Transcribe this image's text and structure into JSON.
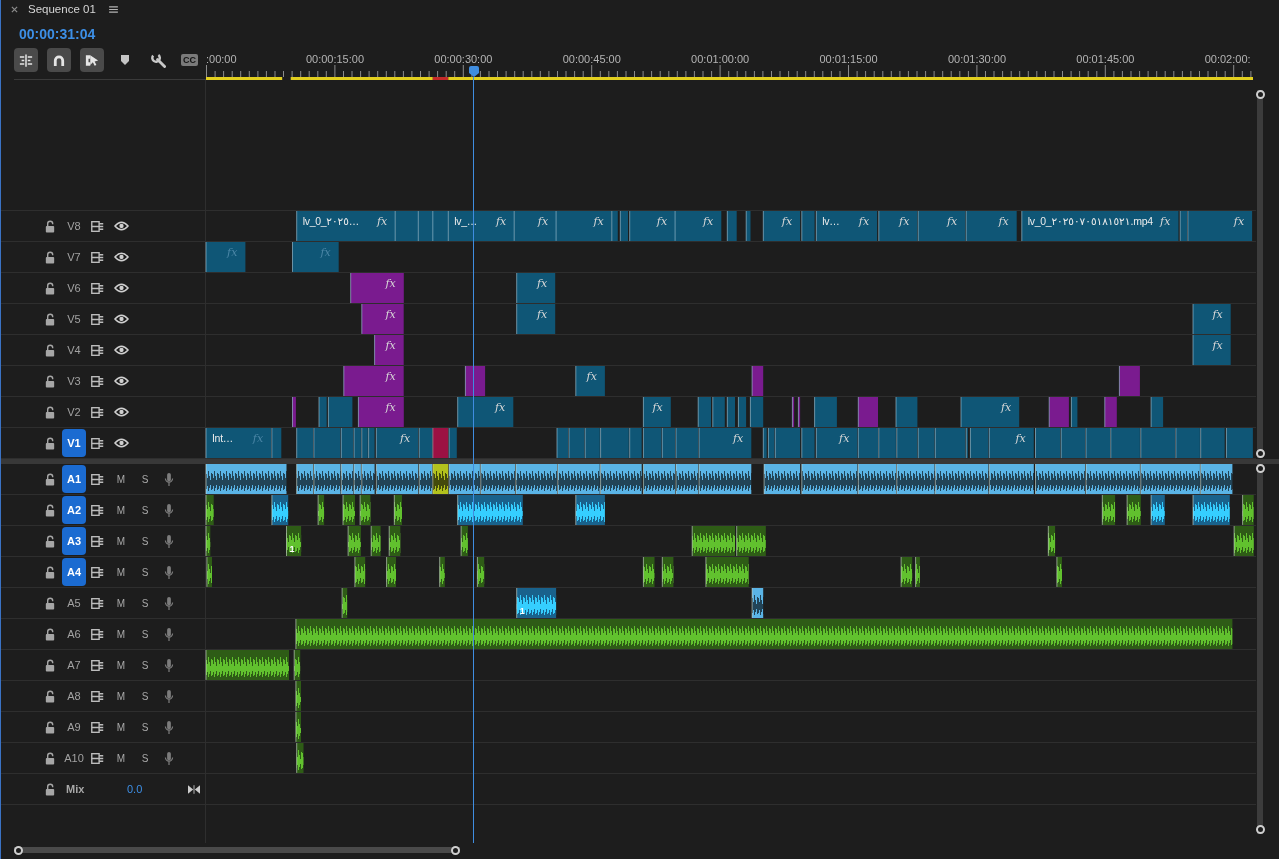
{
  "panel": {
    "title": "Sequence 01"
  },
  "timecode": "00:00:31:04",
  "toolbar": [
    {
      "kind": "nest",
      "on": true
    },
    {
      "kind": "snap",
      "on": true
    },
    {
      "kind": "linked",
      "on": true
    },
    {
      "kind": "marker",
      "on": false
    },
    {
      "kind": "settings",
      "on": false
    },
    {
      "kind": "captions",
      "on": false,
      "text": "CC"
    }
  ],
  "ruler": {
    "labels": [
      ":00:00",
      "00:00:15:00",
      "00:00:30:00",
      "00:00:45:00",
      "00:01:00:00",
      "00:01:15:00",
      "00:01:30:00",
      "00:01:45:00",
      "00:02:00:"
    ],
    "render_bar": [
      {
        "color": "#e2cf1f"
      },
      {
        "color": "#e2cf1f"
      },
      {
        "color": "#c42a2a"
      },
      {
        "color": "#e2cf1f"
      }
    ]
  },
  "video_tracks": [
    {
      "label": "V8",
      "targeted": false,
      "clips": [
        {
          "color": "#0f5676",
          "name": "lv_0_٢٠٢٥…",
          "badge": "fx",
          "badge_dim": false
        },
        {
          "color": "#0f5676"
        },
        {
          "color": "#0f5676"
        },
        {
          "color": "#0f5676"
        },
        {
          "color": "#0f5676",
          "name": "lv_…",
          "badge": "fx",
          "badge_dim": false
        },
        {
          "color": "#0f5676",
          "badge": "fx",
          "badge_dim": false
        },
        {
          "color": "#0f5676",
          "badge": "fx",
          "badge_dim": false
        },
        {
          "color": "#0f5676"
        },
        {
          "color": "#0f5676"
        },
        {
          "color": "#0f5676",
          "badge": "fx",
          "badge_dim": false
        },
        {
          "color": "#0f5676",
          "badge": "fx",
          "badge_dim": false
        },
        {
          "color": "#0f5676"
        },
        {
          "color": "#0f5676"
        },
        {
          "color": "#0f5676",
          "badge": "fx",
          "badge_dim": false
        },
        {
          "color": "#0f5676"
        },
        {
          "color": "#0f5676",
          "name": "lv…",
          "badge": "fx",
          "badge_dim": false
        },
        {
          "color": "#0f5676",
          "badge": "fx",
          "badge_dim": false
        },
        {
          "color": "#0f5676",
          "badge": "fx",
          "badge_dim": false
        },
        {
          "color": "#0f5676",
          "badge": "fx",
          "badge_dim": false
        },
        {
          "color": "#0f5676",
          "name": "lv_0_٢٠٢٥٠٧٠٥١٨١٥٢١.mp4",
          "badge": "fx",
          "badge_dim": false
        },
        {
          "color": "#0f5676"
        },
        {
          "color": "#0f5676",
          "badge": "fx",
          "badge_dim": false
        }
      ]
    },
    {
      "label": "V7",
      "targeted": false,
      "clips": [
        {
          "color": "#0f5676",
          "badge": "fx",
          "badge_dim": true
        },
        {
          "color": "#0f5676",
          "badge": "fx",
          "badge_dim": true
        }
      ]
    },
    {
      "label": "V6",
      "targeted": false,
      "clips": [
        {
          "color": "#7a1b8f",
          "badge": "fx",
          "badge_dim": false
        },
        {
          "color": "#0f5676",
          "badge": "fx",
          "badge_dim": false
        }
      ]
    },
    {
      "label": "V5",
      "targeted": false,
      "clips": [
        {
          "color": "#7a1b8f",
          "badge": "fx",
          "badge_dim": false
        },
        {
          "color": "#0f5676",
          "badge": "fx",
          "badge_dim": false
        },
        {
          "color": "#0f5676",
          "badge": "fx",
          "badge_dim": false
        }
      ]
    },
    {
      "label": "V4",
      "targeted": false,
      "clips": [
        {
          "color": "#7a1b8f",
          "badge": "fx",
          "badge_dim": false
        },
        {
          "color": "#0f5676",
          "badge": "fx",
          "badge_dim": false
        }
      ]
    },
    {
      "label": "V3",
      "targeted": false,
      "clips": [
        {
          "color": "#7a1b8f",
          "badge": "fx",
          "badge_dim": false
        },
        {
          "color": "#7a1b8f"
        },
        {
          "color": "#0f5676",
          "badge": "fx",
          "badge_dim": false
        },
        {
          "color": "#7a1b8f"
        },
        {
          "color": "#7a1b8f"
        }
      ]
    },
    {
      "label": "V2",
      "targeted": false,
      "clips": [
        {
          "color": "#7a1b8f"
        },
        {
          "color": "#0f5676"
        },
        {
          "color": "#0f5676"
        },
        {
          "color": "#7a1b8f",
          "badge": "fx",
          "badge_dim": false
        },
        {
          "color": "#0f5676",
          "badge": "fx",
          "badge_dim": false
        },
        {
          "color": "#0f5676",
          "badge": "fx",
          "badge_dim": false
        },
        {
          "color": "#0f5676"
        },
        {
          "color": "#0f5676"
        },
        {
          "color": "#0f5676"
        },
        {
          "color": "#0f5676"
        },
        {
          "color": "#0f5676"
        },
        {
          "color": "#7a1b8f"
        },
        {
          "color": "#7a1b8f"
        },
        {
          "color": "#0f5676"
        },
        {
          "color": "#7a1b8f"
        },
        {
          "color": "#0f5676"
        },
        {
          "color": "#0f5676",
          "badge": "fx",
          "badge_dim": false
        },
        {
          "color": "#7a1b8f"
        },
        {
          "color": "#0f5676"
        },
        {
          "color": "#7a1b8f"
        },
        {
          "color": "#0f5676"
        }
      ]
    },
    {
      "label": "V1",
      "targeted": true,
      "clips": [
        {
          "color": "#0f5676",
          "name": "Int…",
          "badge": "fx",
          "badge_dim": true
        },
        {
          "color": "#0f5676"
        },
        {
          "color": "#0f5676"
        },
        {
          "color": "#0f5676"
        },
        {
          "color": "#0f5676"
        },
        {
          "color": "#0f5676"
        },
        {
          "color": "#0f5676"
        },
        {
          "color": "#0f5676"
        },
        {
          "color": "#0f5676",
          "badge": "fx",
          "badge_dim": false
        },
        {
          "color": "#0f5676"
        },
        {
          "color": "#9c1143"
        },
        {
          "color": "#0f5676"
        },
        {
          "color": "#0f5676"
        },
        {
          "color": "#0f5676"
        },
        {
          "color": "#0f5676"
        },
        {
          "color": "#0f5676"
        },
        {
          "color": "#0f5676"
        },
        {
          "color": "#0f5676"
        },
        {
          "color": "#0f5676"
        },
        {
          "color": "#0f5676"
        },
        {
          "color": "#0f5676",
          "badge": "fx",
          "badge_dim": false
        },
        {
          "color": "#0f5676"
        },
        {
          "color": "#0f5676"
        },
        {
          "color": "#0f5676"
        },
        {
          "color": "#0f5676"
        },
        {
          "color": "#0f5676",
          "badge": "fx",
          "badge_dim": false
        },
        {
          "color": "#0f5676"
        },
        {
          "color": "#0f5676"
        },
        {
          "color": "#0f5676"
        },
        {
          "color": "#0f5676"
        },
        {
          "color": "#0f5676"
        },
        {
          "color": "#0f5676"
        },
        {
          "color": "#0f5676"
        },
        {
          "color": "#0f5676",
          "badge": "fx",
          "badge_dim": false
        },
        {
          "color": "#0f5676"
        },
        {
          "color": "#0f5676"
        },
        {
          "color": "#0f5676"
        },
        {
          "color": "#0f5676"
        },
        {
          "color": "#0f5676"
        },
        {
          "color": "#0f5676"
        },
        {
          "color": "#0f5676"
        },
        {
          "color": "#0f5676"
        }
      ]
    }
  ],
  "audio_tracks": [
    {
      "label": "A1",
      "targeted": true,
      "mute_label": "M",
      "solo_label": "S",
      "clips": [
        {
          "color": "#5ab4e6"
        },
        {
          "color": "#5ab4e6"
        },
        {
          "color": "#5ab4e6"
        },
        {
          "color": "#5ab4e6"
        },
        {
          "color": "#5ab4e6"
        },
        {
          "color": "#5ab4e6"
        },
        {
          "color": "#5ab4e6"
        },
        {
          "color": "#5ab4e6"
        },
        {
          "color": "#b3c21d"
        },
        {
          "color": "#5ab4e6"
        },
        {
          "color": "#5ab4e6"
        },
        {
          "color": "#5ab4e6"
        },
        {
          "color": "#5ab4e6"
        },
        {
          "color": "#5ab4e6"
        },
        {
          "color": "#5ab4e6"
        },
        {
          "color": "#5ab4e6"
        },
        {
          "color": "#5ab4e6"
        },
        {
          "color": "#5ab4e6"
        },
        {
          "color": "#5ab4e6"
        },
        {
          "color": "#5ab4e6"
        },
        {
          "color": "#5ab4e6"
        },
        {
          "color": "#5ab4e6"
        },
        {
          "color": "#5ab4e6"
        },
        {
          "color": "#5ab4e6"
        },
        {
          "color": "#5ab4e6"
        },
        {
          "color": "#5ab4e6"
        },
        {
          "color": "#5ab4e6"
        }
      ]
    },
    {
      "label": "A2",
      "targeted": true,
      "mute_label": "M",
      "solo_label": "S",
      "clips": [
        {
          "color": "#2e5c16"
        },
        {
          "color": "#19628c"
        },
        {
          "color": "#2e5c16"
        },
        {
          "color": "#2e5c16"
        },
        {
          "color": "#2e5c16"
        },
        {
          "color": "#2e5c16"
        },
        {
          "color": "#19628c"
        },
        {
          "color": "#19628c"
        },
        {
          "color": "#2e5c16"
        },
        {
          "color": "#2e5c16"
        },
        {
          "color": "#19628c"
        },
        {
          "color": "#19628c"
        },
        {
          "color": "#2e5c16"
        }
      ]
    },
    {
      "label": "A3",
      "targeted": true,
      "mute_label": "M",
      "solo_label": "S",
      "clips": [
        {
          "color": "#2e5c16"
        },
        {
          "color": "#2e5c16",
          "name": "1"
        },
        {
          "color": "#2e5c16"
        },
        {
          "color": "#2e5c16"
        },
        {
          "color": "#2e5c16"
        },
        {
          "color": "#2e5c16"
        },
        {
          "color": "#2e5c16"
        },
        {
          "color": "#2e5c16"
        },
        {
          "color": "#2e5c16"
        },
        {
          "color": "#2e5c16"
        }
      ]
    },
    {
      "label": "A4",
      "targeted": true,
      "mute_label": "M",
      "solo_label": "S",
      "clips": [
        {
          "color": "#2e5c16"
        },
        {
          "color": "#2e5c16"
        },
        {
          "color": "#2e5c16"
        },
        {
          "color": "#2e5c16"
        },
        {
          "color": "#2e5c16"
        },
        {
          "color": "#2e5c16"
        },
        {
          "color": "#2e5c16"
        },
        {
          "color": "#2e5c16"
        },
        {
          "color": "#2e5c16"
        },
        {
          "color": "#2e5c16"
        },
        {
          "color": "#2e5c16"
        }
      ]
    },
    {
      "label": "A5",
      "targeted": false,
      "mute_label": "M",
      "solo_label": "S",
      "clips": [
        {
          "color": "#2e5c16"
        },
        {
          "color": "#19628c",
          "name": "1"
        },
        {
          "color": "#5ab4e6"
        }
      ]
    },
    {
      "label": "A6",
      "targeted": false,
      "mute_label": "M",
      "solo_label": "S",
      "clips": [
        {
          "color": "#2e5c16"
        }
      ]
    },
    {
      "label": "A7",
      "targeted": false,
      "mute_label": "M",
      "solo_label": "S",
      "clips": [
        {
          "color": "#2e5c16"
        },
        {
          "color": "#2e5c16"
        }
      ]
    },
    {
      "label": "A8",
      "targeted": false,
      "mute_label": "M",
      "solo_label": "S",
      "clips": [
        {
          "color": "#2e5c16"
        }
      ]
    },
    {
      "label": "A9",
      "targeted": false,
      "mute_label": "M",
      "solo_label": "S",
      "clips": [
        {
          "color": "#2e5c16"
        }
      ]
    },
    {
      "label": "A10",
      "targeted": false,
      "mute_label": "M",
      "solo_label": "S",
      "clips": [
        {
          "color": "#2e5c16"
        }
      ]
    }
  ],
  "mix": {
    "label": "Mix",
    "value": "0.0"
  }
}
